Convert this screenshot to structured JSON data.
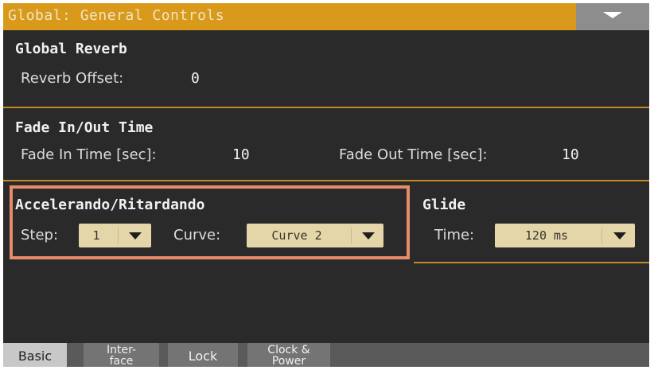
{
  "window": {
    "title": "Global: General Controls",
    "menu_icon": "chevron-down-icon"
  },
  "global_reverb": {
    "heading": "Global Reverb",
    "reverb_offset_label": "Reverb Offset:",
    "reverb_offset_value": "0"
  },
  "fade_time": {
    "heading": "Fade In/Out Time",
    "fade_in_label": "Fade In Time [sec]:",
    "fade_in_value": "10",
    "fade_out_label": "Fade Out Time [sec]:",
    "fade_out_value": "10"
  },
  "accelerando": {
    "heading": "Accelerando/Ritardando",
    "step_label": "Step:",
    "step_value": "1",
    "curve_label": "Curve:",
    "curve_value": "Curve 2"
  },
  "glide": {
    "heading": "Glide",
    "time_label": "Time:",
    "time_value": "120 ms"
  },
  "tabs": [
    {
      "label": "Basic",
      "line1": "Basic",
      "line2": "",
      "active": true
    },
    {
      "label": "Inter-face",
      "line1": "Inter-",
      "line2": "face",
      "active": false
    },
    {
      "label": "Lock",
      "line1": "Lock",
      "line2": "",
      "active": false
    },
    {
      "label": "Clock & Power",
      "line1": "Clock &",
      "line2": "Power",
      "active": false
    }
  ],
  "colors": {
    "title_bar": "#d99a1c",
    "background": "#2a2a2b",
    "dropdown": "#e5d6a9",
    "divider": "#c58a27",
    "highlight": "#e78b68",
    "menu_button": "#8d8d8d"
  }
}
